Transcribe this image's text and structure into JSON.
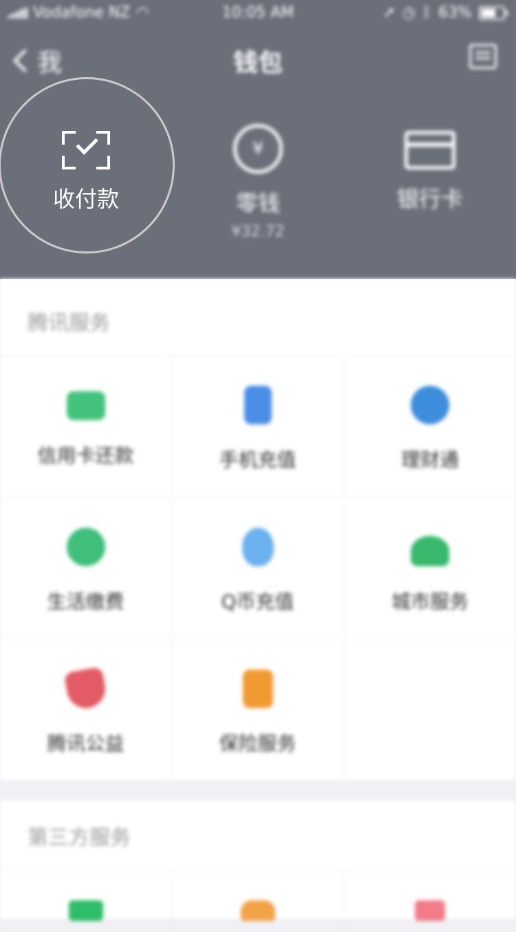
{
  "status_bar": {
    "carrier": "Vodafone NZ",
    "time": "10:05 AM",
    "battery": "63%"
  },
  "nav": {
    "back_label": "我",
    "title": "钱包"
  },
  "top_actions": [
    {
      "label": "收付款",
      "icon": "scan-check-icon"
    },
    {
      "label": "零钱",
      "sub": "¥32.72",
      "icon": "coin-icon"
    },
    {
      "label": "银行卡",
      "icon": "bank-card-icon"
    }
  ],
  "tencent_services": {
    "title": "腾讯服务",
    "items": [
      {
        "label": "信用卡还款",
        "icon": "credit-card-icon",
        "color": "#43c27d"
      },
      {
        "label": "手机充值",
        "icon": "phone-icon",
        "color": "#4a8ee8"
      },
      {
        "label": "理财通",
        "icon": "licaitong-icon",
        "color": "#3c8ddc"
      },
      {
        "label": "生活缴费",
        "icon": "life-fee-icon",
        "color": "#3fbf7b"
      },
      {
        "label": "Q币充值",
        "icon": "qq-penguin-icon",
        "color": "#6ab1ee"
      },
      {
        "label": "城市服务",
        "icon": "city-icon",
        "color": "#37b86c"
      },
      {
        "label": "腾讯公益",
        "icon": "charity-heart-icon",
        "color": "#e35c65"
      },
      {
        "label": "保险服务",
        "icon": "insurance-icon",
        "color": "#f19a32"
      }
    ]
  },
  "third_party_services": {
    "title": "第三方服务",
    "icons": [
      {
        "icon": "green-service-icon",
        "color": "#2fbd69"
      },
      {
        "icon": "orange-service-icon",
        "color": "#f3a24a"
      },
      {
        "icon": "pink-service-icon",
        "color": "#f27c88"
      }
    ]
  }
}
